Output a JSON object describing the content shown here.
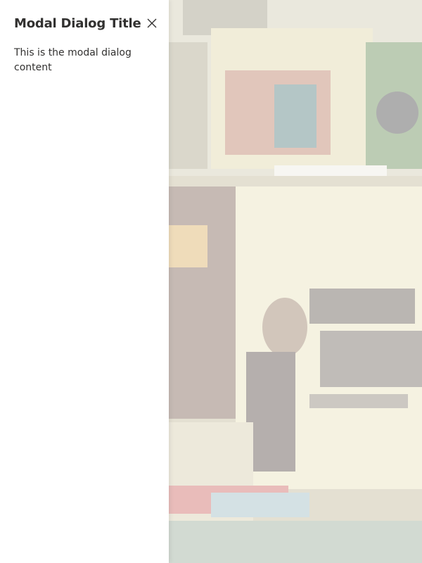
{
  "dialog": {
    "title": "Modal Dialog Title",
    "content": "This is the modal dialog content",
    "close_icon": "close-icon"
  },
  "colors": {
    "panel_background": "#ffffff",
    "text": "#323130",
    "overlay": "rgba(255,255,255,0.62)"
  }
}
